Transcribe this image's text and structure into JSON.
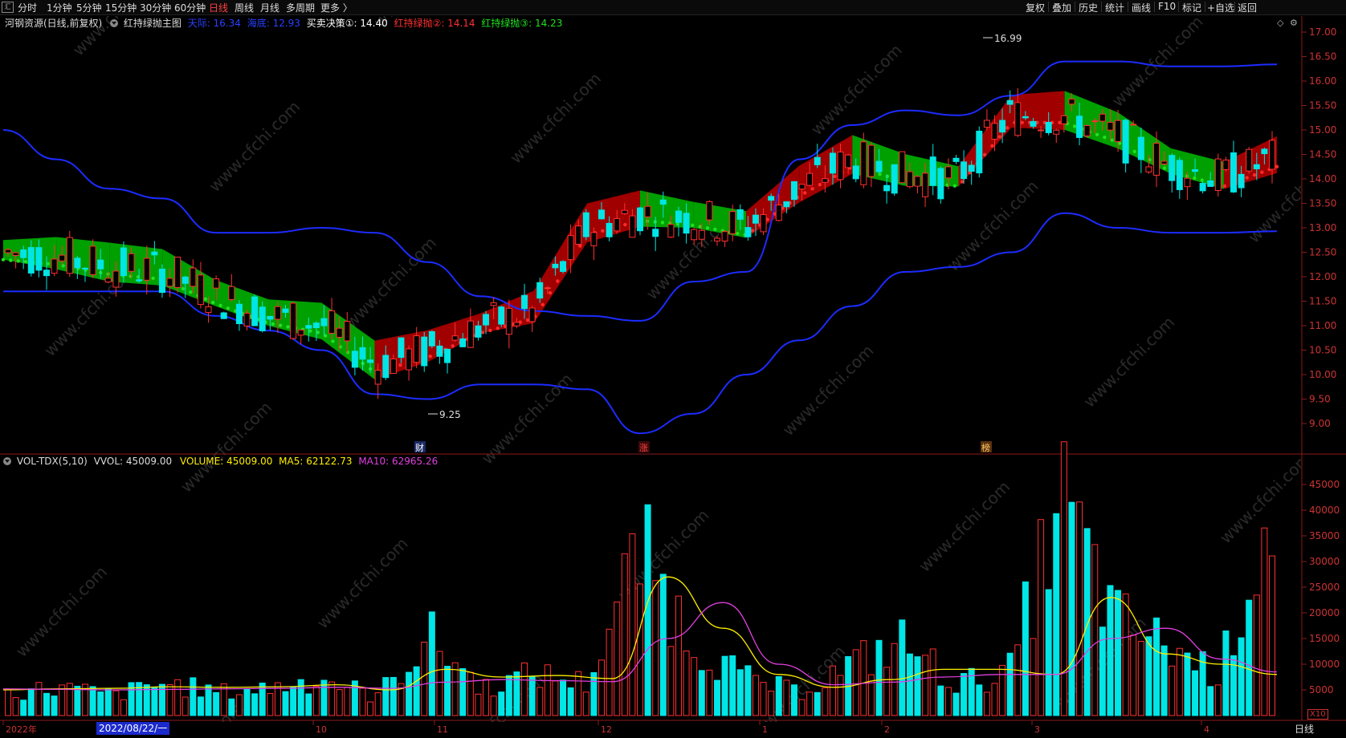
{
  "toolbar": {
    "periods": [
      "分时",
      "1分钟",
      "5分钟",
      "15分钟",
      "30分钟",
      "60分钟",
      "日线",
      "周线",
      "月线",
      "多周期",
      "更多 〉"
    ],
    "active_period": "日线",
    "right_buttons": [
      "复权",
      "叠加",
      "历史",
      "统计",
      "画线",
      "F10",
      "标记",
      "+自选",
      "返回"
    ]
  },
  "legend": {
    "stock": "河钢资源(日线,前复权)",
    "indicator": "红持绿抛主图",
    "tianlong_label": "天际: 16.34",
    "hailong_label": "海底: 12.93",
    "buysell_label": "买卖决策①: 14.40",
    "red2_label": "红持绿抛②: 14.14",
    "green3_label": "红持绿抛③: 14.23"
  },
  "price_axis": [
    "17.00",
    "16.50",
    "16.00",
    "15.50",
    "15.00",
    "14.50",
    "14.00",
    "13.50",
    "13.00",
    "12.50",
    "12.00",
    "11.50",
    "11.00",
    "10.50",
    "10.00",
    "9.50",
    "9.00"
  ],
  "annotations": {
    "high": "16.99",
    "low": "9.25",
    "cai": "财",
    "zhang": "涨",
    "bang": "榜"
  },
  "volume_legend": {
    "name": "VOL-TDX(5,10)",
    "vvol": "VVOL: 45009.00",
    "volume": "VOLUME: 45009.00",
    "ma5": "MA5: 62122.73",
    "ma10": "MA10: 62965.26"
  },
  "volume_axis": [
    "45000",
    "40000",
    "35000",
    "30000",
    "25000",
    "20000",
    "15000",
    "10000",
    "5000"
  ],
  "volume_unit": "X10",
  "date_axis": [
    "2022年",
    "10",
    "11",
    "12",
    "1",
    "2",
    "3",
    "4"
  ],
  "selected_date": "2022/08/22/一",
  "bottom_tab": "日线",
  "watermark": "www.cfchi.com",
  "colors": {
    "up": "#ff3030",
    "down": "#00e5e5",
    "upper_band": "#1c2cff",
    "red_ribbon": "#a00000",
    "green_ribbon": "#00a000"
  },
  "chart_data": [
    {
      "type": "line",
      "title": "河钢资源(日线,前复权)",
      "ylim": [
        8.8,
        17.2
      ],
      "series": [
        {
          "name": "天际",
          "values": [
            15.0,
            14.4,
            13.8,
            13.6,
            12.9,
            12.9,
            13.0,
            12.9,
            12.3,
            11.6,
            11.3,
            11.2,
            11.1,
            11.9,
            12.1,
            14.4,
            15.1,
            15.4,
            15.3,
            15.7,
            16.4,
            16.4,
            16.3,
            16.3,
            16.34
          ]
        },
        {
          "name": "海底",
          "values": [
            11.7,
            11.7,
            11.7,
            11.7,
            11.2,
            10.9,
            10.5,
            9.6,
            9.5,
            9.8,
            9.8,
            9.7,
            8.8,
            9.2,
            10.0,
            10.7,
            11.4,
            12.1,
            12.2,
            12.5,
            13.3,
            13.0,
            12.9,
            12.9,
            12.93
          ]
        },
        {
          "name": "买卖决策①",
          "values": [
            12.5,
            12.4,
            12.2,
            12.1,
            11.6,
            11.2,
            11.0,
            10.2,
            10.5,
            11.0,
            11.3,
            13.0,
            13.3,
            13.2,
            13.0,
            13.8,
            14.4,
            14.1,
            14.0,
            15.3,
            15.3,
            14.9,
            14.3,
            14.0,
            14.4
          ]
        }
      ]
    },
    {
      "type": "bar",
      "title": "VOL-TDX(5,10)",
      "series": [
        {
          "name": "VOLUME",
          "values": [
            5000,
            6000,
            4500,
            7000,
            5000,
            6000,
            8000,
            4000,
            17000,
            6000,
            9000,
            7000,
            36000,
            16000,
            8000,
            5000,
            11000,
            16000,
            7000,
            9000,
            47000,
            21000,
            15000,
            9000,
            45009
          ]
        },
        {
          "name": "MA5",
          "values": [
            5000,
            5200,
            5300,
            5600,
            5500,
            5600,
            6000,
            5000,
            9000,
            7500,
            7800,
            7200,
            27000,
            17000,
            8000,
            5500,
            7000,
            9000,
            9000,
            8000,
            23000,
            12000,
            10000,
            8000,
            62122.73
          ]
        },
        {
          "name": "MA10",
          "values": [
            5200,
            5100,
            5000,
            5100,
            5200,
            5300,
            5500,
            5300,
            6500,
            7000,
            6800,
            6600,
            15000,
            22000,
            10000,
            6000,
            6500,
            7500,
            8000,
            8000,
            15000,
            17000,
            11000,
            8500,
            62965.26
          ]
        }
      ]
    }
  ]
}
